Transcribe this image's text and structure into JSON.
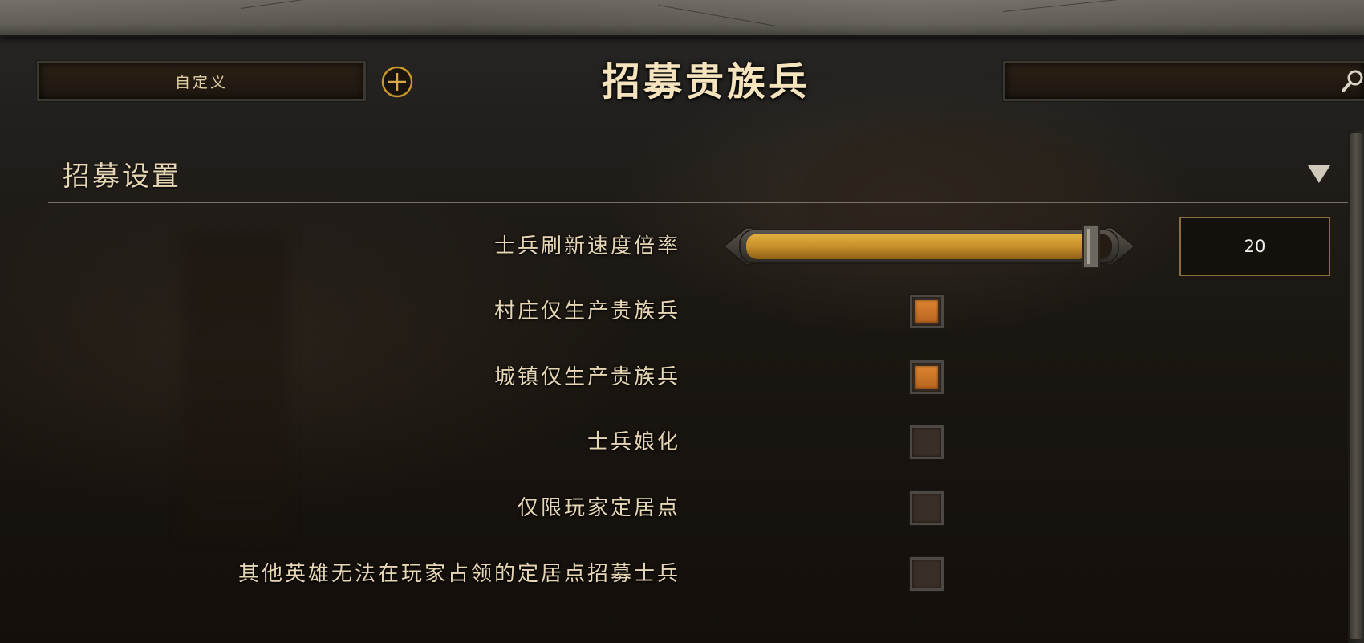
{
  "header": {
    "preset_label": "自定义",
    "title": "招募贵族兵",
    "search_value": ""
  },
  "section": {
    "title": "招募设置",
    "settings": [
      {
        "label": "士兵刷新速度倍率",
        "type": "slider",
        "value": "20",
        "fill_fraction": 0.97
      },
      {
        "label": "村庄仅生产贵族兵",
        "type": "checkbox",
        "checked": true
      },
      {
        "label": "城镇仅生产贵族兵",
        "type": "checkbox",
        "checked": true
      },
      {
        "label": "士兵娘化",
        "type": "checkbox",
        "checked": false
      },
      {
        "label": "仅限玩家定居点",
        "type": "checkbox",
        "checked": false
      },
      {
        "label": "其他英雄无法在玩家占领的定居点招募士兵",
        "type": "checkbox",
        "checked": false
      }
    ]
  },
  "colors": {
    "accent_gold": "#c8962a",
    "checkbox_checked": "#d07a2b",
    "text": "#e6d6b4"
  },
  "icons": {
    "add": "plus-circle-icon",
    "search": "search-icon",
    "collapse": "triangle-down-icon"
  }
}
